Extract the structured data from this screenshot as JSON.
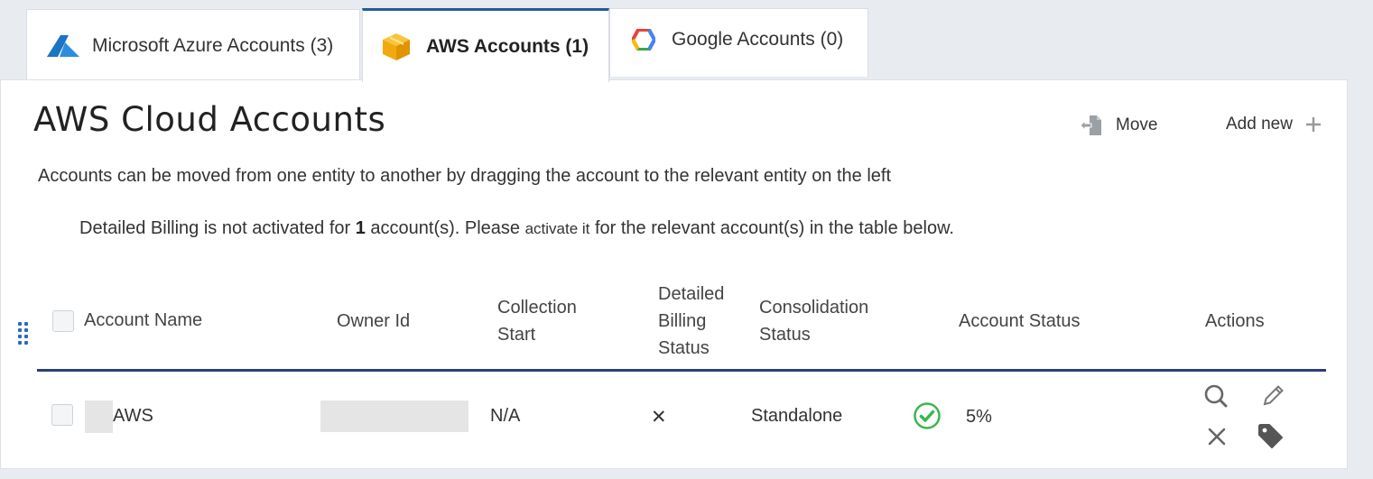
{
  "tabs": [
    {
      "label": "Microsoft Azure Accounts (3)",
      "icon": "azure-logo-icon"
    },
    {
      "label": "AWS Accounts (1)",
      "icon": "aws-cube-icon",
      "active": true
    },
    {
      "label": "Google Accounts (0)",
      "icon": "google-cloud-logo-icon"
    }
  ],
  "page": {
    "title": "AWS Cloud Accounts",
    "move_label": "Move",
    "add_new_label": "Add new",
    "info": "Accounts can be moved from one entity to another by dragging the account to the relevant entity on the left",
    "billing_note": {
      "prefix": "Detailed Billing is not activated for ",
      "count": "1",
      "middle": " account(s). Please ",
      "link": "activate it",
      "suffix": " for the relevant account(s) in the table below."
    }
  },
  "table": {
    "headers": {
      "account_name": "Account Name",
      "owner_id": "Owner Id",
      "collection_start_1": "Collection",
      "collection_start_2": "Start",
      "detailed_billing_1": "Detailed",
      "detailed_billing_2": "Billing",
      "detailed_billing_3": "Status",
      "consolidation_1": "Consolidation",
      "consolidation_2": "Status",
      "account_status": "Account Status",
      "actions": "Actions"
    },
    "rows": [
      {
        "account_name": "AWS",
        "collection_start": "N/A",
        "detailed_billing": "✕",
        "consolidation_status": "Standalone",
        "account_status": "5%",
        "status_icon": "check-circle-icon"
      }
    ]
  },
  "colors": {
    "active_tab_border": "#1f5d99",
    "table_header_border": "#2c3e74",
    "success_green": "#3cb54a",
    "drag_handle": "#2a69c4"
  }
}
